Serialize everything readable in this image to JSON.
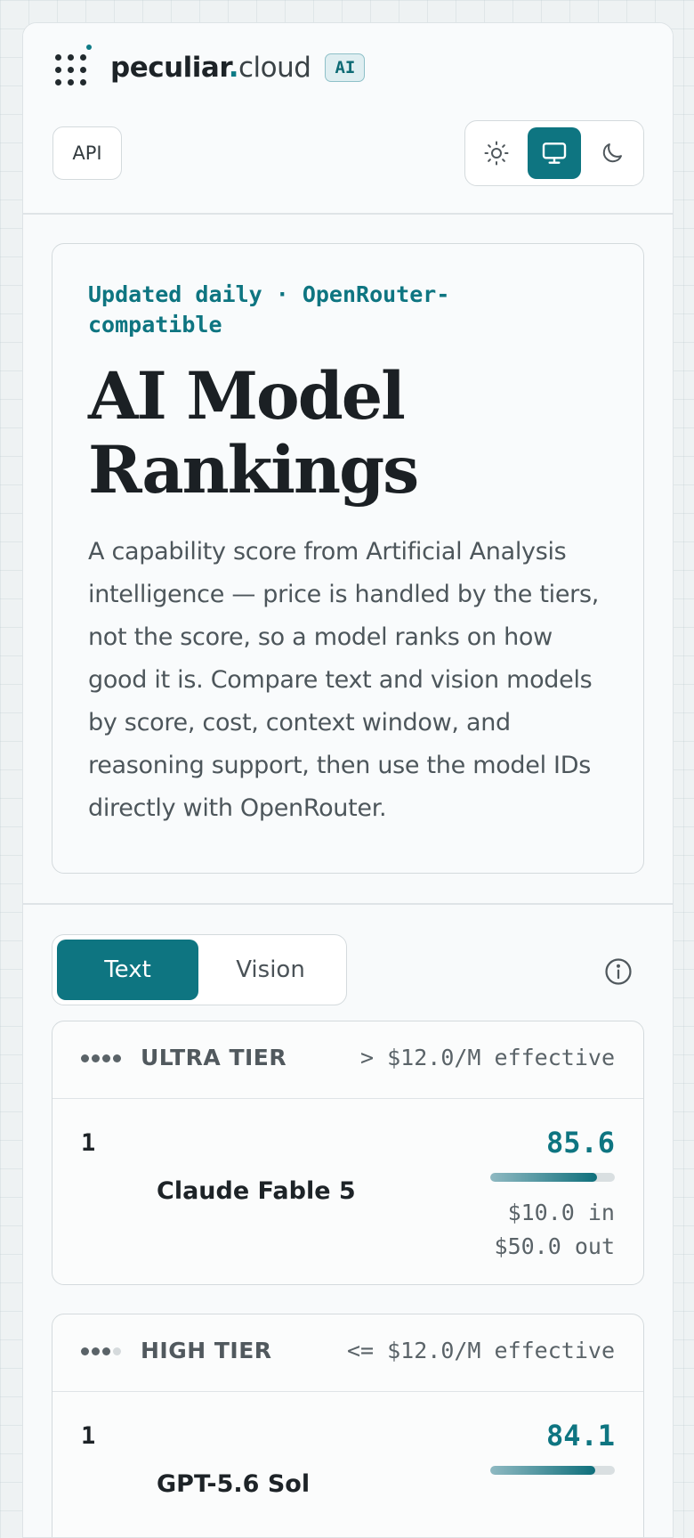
{
  "brand": {
    "name": "peculiar",
    "dot": ".",
    "tld": "cloud",
    "badge": "AI"
  },
  "header": {
    "api_label": "API",
    "theme_options": [
      "light-theme",
      "system-theme",
      "dark-theme"
    ],
    "active_theme": "system-theme"
  },
  "hero": {
    "eyebrow": "Updated daily · OpenRouter-compatible",
    "title": "AI Model Rankings",
    "description": "A capability score from Artificial Analysis intelligence — price is handled by the tiers, not the score, so a model ranks on how good it is. Compare text and vision models by score, cost, context window, and reasoning support, then use the model IDs directly with OpenRouter."
  },
  "tabs": {
    "items": [
      "Text",
      "Vision"
    ],
    "active": "Text"
  },
  "tiers": [
    {
      "name": "ULTRA TIER",
      "price": "> $12.0/M effective",
      "level": 4,
      "models": [
        {
          "rank": "1",
          "name": "Claude Fable 5",
          "score": "85.6",
          "score_fraction": 0.856,
          "cost_in": "$10.0 in",
          "cost_out": "$50.0 out"
        }
      ]
    },
    {
      "name": "HIGH TIER",
      "price": "<= $12.0/M effective",
      "level": 3,
      "models": [
        {
          "rank": "1",
          "name": "GPT-5.6 Sol",
          "score": "84.1",
          "score_fraction": 0.841,
          "cost_in": "",
          "cost_out": ""
        }
      ]
    }
  ],
  "colors": {
    "accent": "#0e7581",
    "text": "#1d2327",
    "muted": "#5a6368"
  }
}
